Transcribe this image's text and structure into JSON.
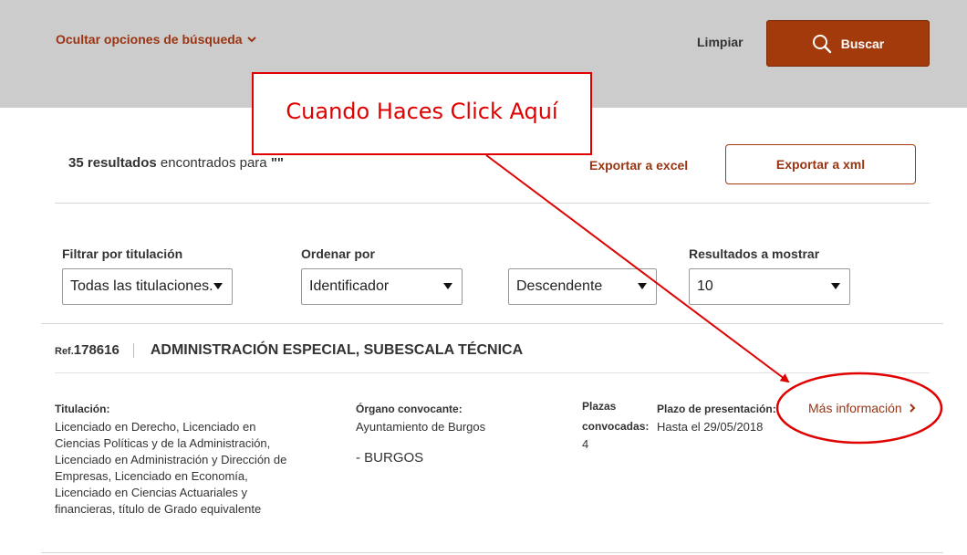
{
  "header": {
    "toggle_options": "Ocultar opciones de búsqueda",
    "clear": "Limpiar",
    "search": "Buscar"
  },
  "results": {
    "count": "35 resultados",
    "found_text": " encontrados para ",
    "query": "\"\""
  },
  "export": {
    "excel": "Exportar a excel",
    "xml": "Exportar a xml"
  },
  "filters": {
    "titulacion_label": "Filtrar por titulación",
    "titulacion_value": "Todas las titulaciones.",
    "order_label": "Ordenar por",
    "order_value": "Identificador",
    "direction_value": "Descendente",
    "show_label": "Resultados a mostrar",
    "show_value": "10"
  },
  "item": {
    "ref_label": "Ref.",
    "ref_number": "178616",
    "title": "ADMINISTRACIÓN ESPECIAL, SUBESCALA TÉCNICA",
    "titulacion_label": "Titulación:",
    "titulacion_lines": [
      "Licenciado en Derecho, Licenciado en",
      "Ciencias Políticas y de la Administración,",
      "Licenciado en Administración y Dirección de",
      "Empresas, Licenciado en Economía,",
      "Licenciado en Ciencias Actuariales y",
      "financieras, título de Grado equivalente"
    ],
    "organo_label": "Órgano convocante:",
    "organo_value": "Ayuntamiento de Burgos",
    "location": "- BURGOS",
    "plazas_label_1": "Plazas",
    "plazas_label_2": "convocadas:",
    "plazas_value": "4",
    "plazo_label": "Plazo de presentación:",
    "plazo_value": "Hasta el 29/05/2018",
    "more_info": "Más información"
  },
  "annotation": {
    "callout": "Cuando Haces Click Aquí",
    "color": "#e00000"
  },
  "icons": {
    "toggle": "chevron-down-icon",
    "search": "search-icon",
    "more_info": "chevron-right-icon",
    "select": "caret-down-icon"
  },
  "colors": {
    "accent": "#a33a0b",
    "link": "#9a3412",
    "topbar": "#cccccc"
  }
}
